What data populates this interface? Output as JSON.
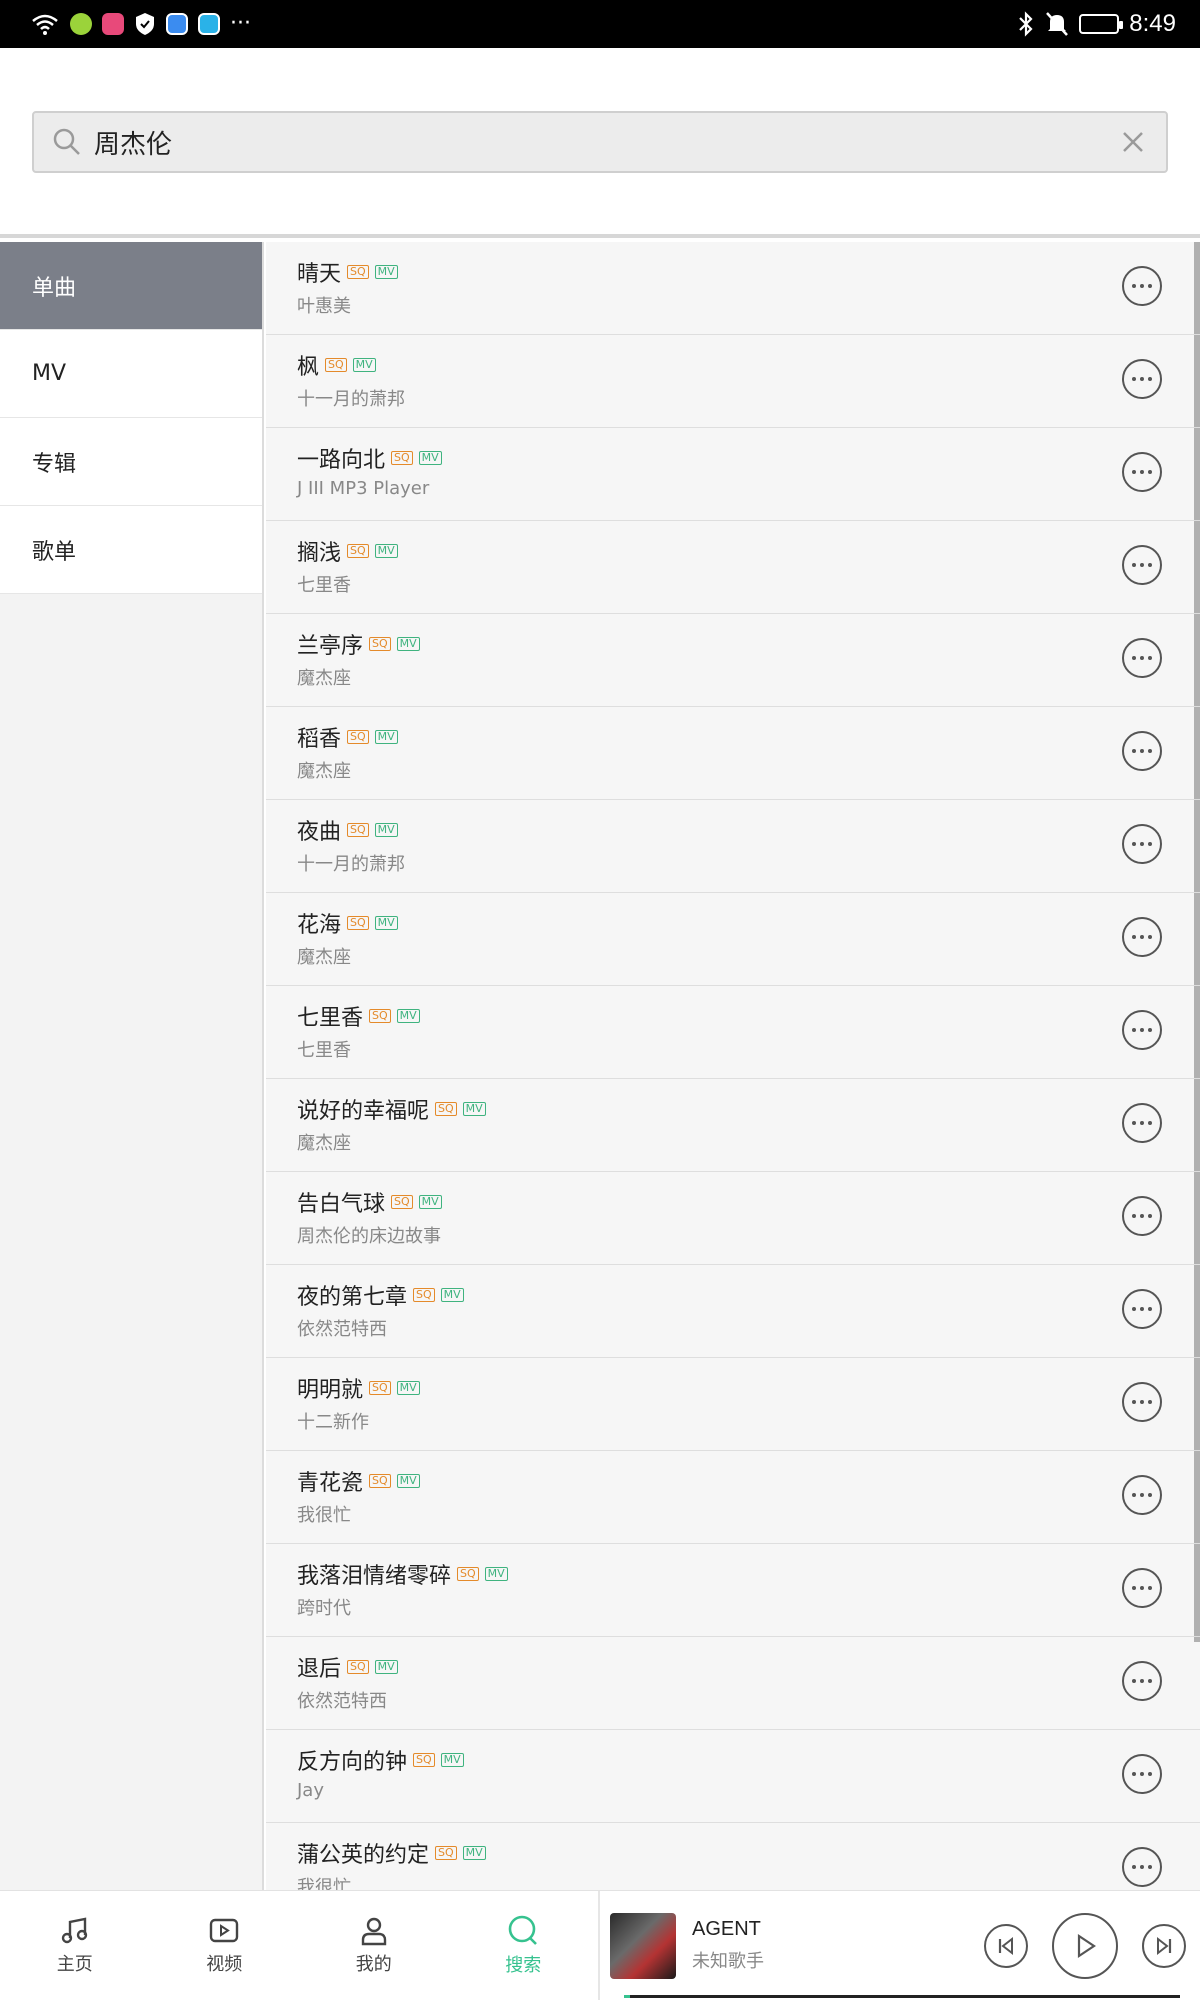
{
  "status_bar": {
    "time": "8:49",
    "icons": [
      "wifi-icon",
      "app-icon-green",
      "app-icon-pink",
      "shield-icon",
      "app-icon-blue",
      "app-icon-book",
      "more-dots-icon",
      "bluetooth-icon",
      "mute-icon",
      "battery-icon"
    ],
    "more": "···"
  },
  "search": {
    "value": "周杰伦",
    "placeholder": ""
  },
  "sidebar": {
    "items": [
      {
        "label": "单曲",
        "active": true
      },
      {
        "label": "MV",
        "active": false
      },
      {
        "label": "专辑",
        "active": false
      },
      {
        "label": "歌单",
        "active": false
      }
    ]
  },
  "songs": [
    {
      "title": "晴天",
      "artist": "叶惠美"
    },
    {
      "title": "枫",
      "artist": "十一月的萧邦"
    },
    {
      "title": "一路向北",
      "artist": "J III MP3 Player"
    },
    {
      "title": "搁浅",
      "artist": "七里香"
    },
    {
      "title": "兰亭序",
      "artist": "魔杰座"
    },
    {
      "title": "稻香",
      "artist": "魔杰座"
    },
    {
      "title": "夜曲",
      "artist": "十一月的萧邦"
    },
    {
      "title": "花海",
      "artist": "魔杰座"
    },
    {
      "title": "七里香",
      "artist": "七里香"
    },
    {
      "title": "说好的幸福呢",
      "artist": "魔杰座"
    },
    {
      "title": "告白气球",
      "artist": "周杰伦的床边故事"
    },
    {
      "title": "夜的第七章",
      "artist": "依然范特西"
    },
    {
      "title": "明明就",
      "artist": "十二新作"
    },
    {
      "title": "青花瓷",
      "artist": "我很忙"
    },
    {
      "title": "我落泪情绪零碎",
      "artist": "跨时代"
    },
    {
      "title": "退后",
      "artist": "依然范特西"
    },
    {
      "title": "反方向的钟",
      "artist": "Jay"
    },
    {
      "title": "蒲公英的约定",
      "artist": "我很忙"
    }
  ],
  "tags": {
    "sq": "SQ",
    "mv": "MV"
  },
  "tabs": [
    {
      "label": "主页",
      "icon": "music-note-icon",
      "active": false
    },
    {
      "label": "视频",
      "icon": "video-icon",
      "active": false
    },
    {
      "label": "我的",
      "icon": "user-icon",
      "active": false
    },
    {
      "label": "搜索",
      "icon": "search-icon",
      "active": true
    }
  ],
  "player": {
    "title": "AGENT",
    "artist": "未知歌手",
    "progress": 0.01
  },
  "colors": {
    "accent": "#36c28f",
    "sq_tag": "#e48a2a",
    "mv_tag": "#3fb37f",
    "sidebar_active": "#7b7f89"
  }
}
